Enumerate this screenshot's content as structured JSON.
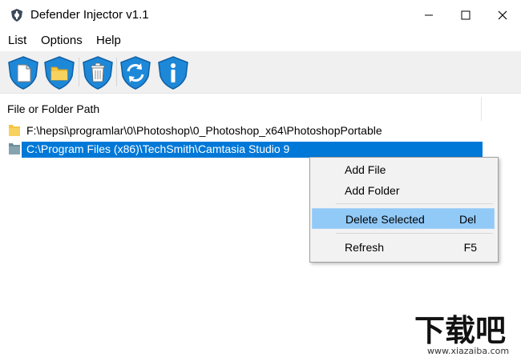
{
  "window": {
    "title": "Defender Injector v1.1",
    "controls": [
      "minimize",
      "maximize",
      "close"
    ]
  },
  "menu": {
    "items": [
      {
        "label": "List"
      },
      {
        "label": "Options"
      },
      {
        "label": "Help"
      }
    ]
  },
  "toolbar": {
    "buttons": [
      {
        "icon": "new-file-shield-icon"
      },
      {
        "icon": "add-folder-shield-icon"
      },
      {
        "icon": "delete-shield-icon"
      },
      {
        "icon": "refresh-shield-icon"
      },
      {
        "icon": "info-shield-icon"
      }
    ]
  },
  "list": {
    "column_header": "File or Folder Path",
    "rows": [
      {
        "path": "F:\\hepsi\\programlar\\0\\Photoshop\\0_Photoshop_x64\\PhotoshopPortable",
        "selected": false
      },
      {
        "path": "C:\\Program Files (x86)\\TechSmith\\Camtasia Studio 9",
        "selected": true
      }
    ]
  },
  "context_menu": {
    "items": [
      {
        "label": "Add File",
        "shortcut": ""
      },
      {
        "label": "Add Folder",
        "shortcut": ""
      },
      {
        "label": "Delete Selected",
        "shortcut": "Del",
        "highlighted": true
      },
      {
        "label": "Refresh",
        "shortcut": "F5"
      }
    ]
  },
  "watermark": {
    "text": "下载吧",
    "url_text": "www.xiazaiba.com"
  },
  "colors": {
    "selection": "#0078d7",
    "menu_highlight": "#91c9f7",
    "shield_blue": "#1e88d8",
    "folder_yellow": "#f5c542"
  }
}
